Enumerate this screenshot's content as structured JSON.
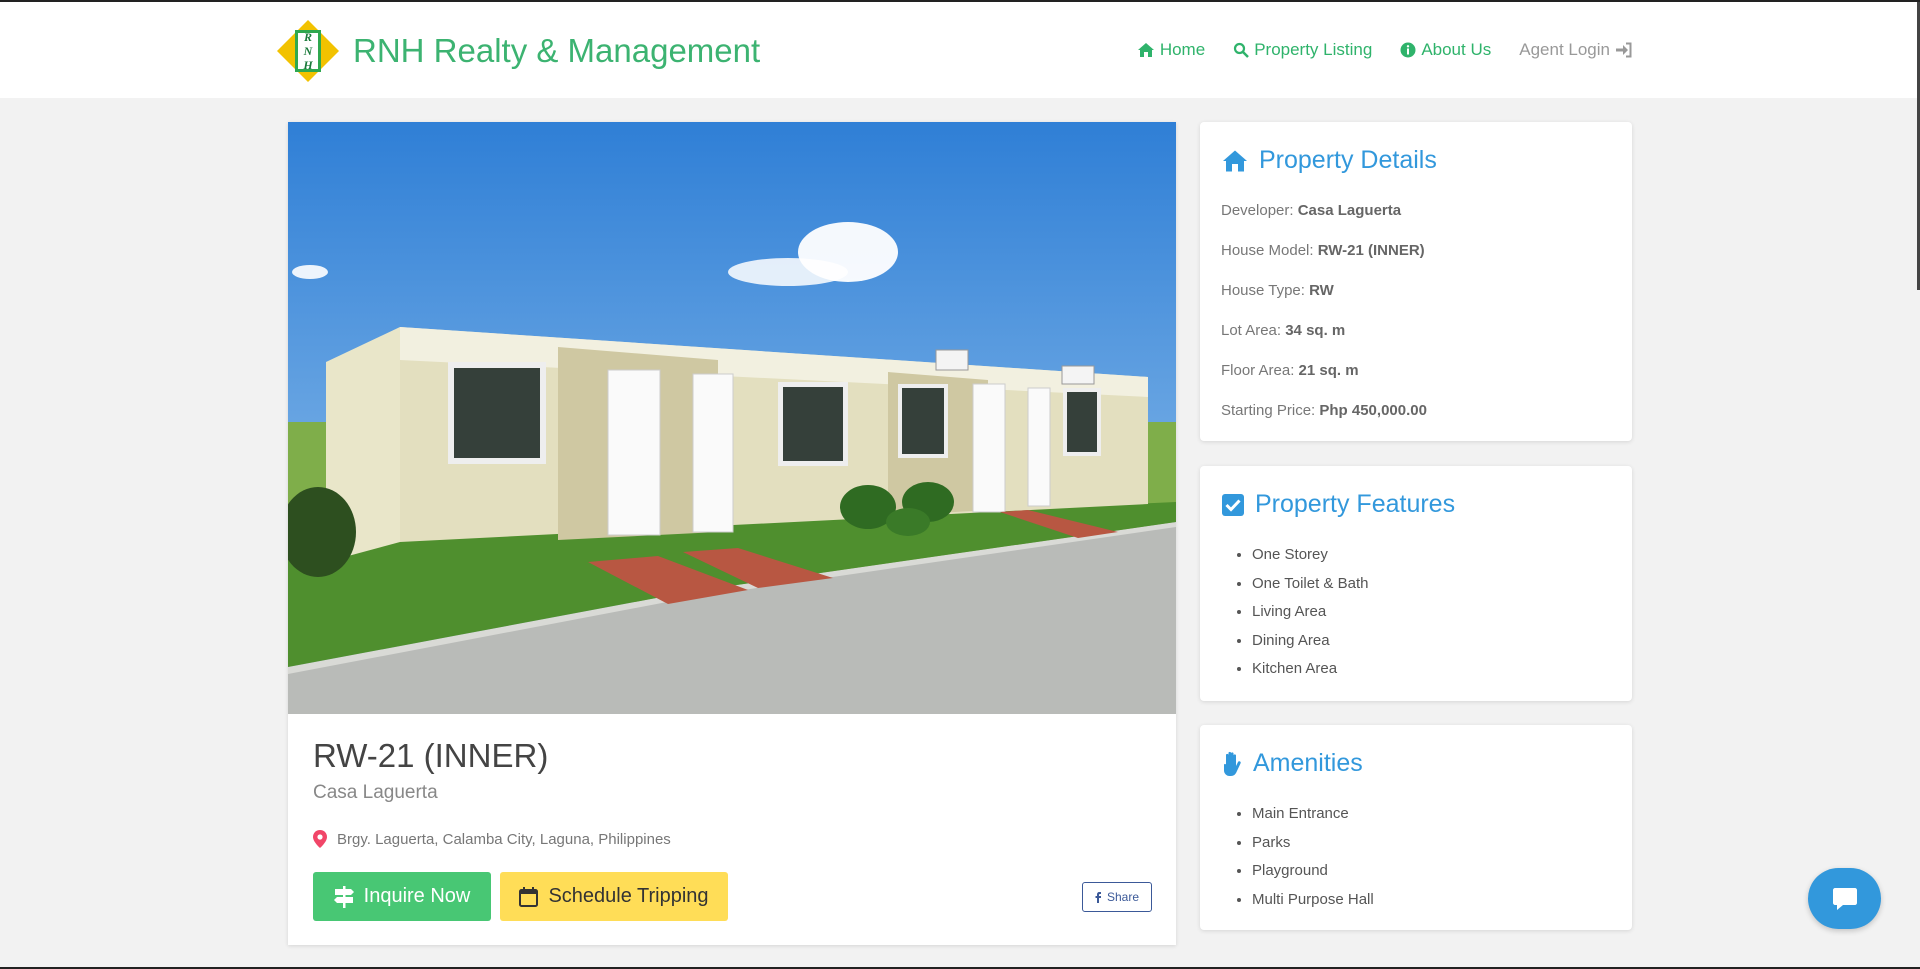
{
  "brand": {
    "name": "RNH Realty & Management",
    "logo_letters": [
      "R",
      "N",
      "H"
    ]
  },
  "nav": {
    "home": "Home",
    "listing": "Property Listing",
    "about": "About Us",
    "login": "Agent Login"
  },
  "property": {
    "title": "RW-21 (INNER)",
    "developer": "Casa Laguerta",
    "address": "Brgy. Laguerta, Calamba City, Laguna, Philippines"
  },
  "actions": {
    "inquire": "Inquire Now",
    "schedule": "Schedule Tripping",
    "share": "Share"
  },
  "details": {
    "heading": "Property Details",
    "rows": [
      {
        "label": "Developer: ",
        "value": "Casa Laguerta"
      },
      {
        "label": "House Model: ",
        "value": "RW-21 (INNER)"
      },
      {
        "label": "House Type: ",
        "value": "RW"
      },
      {
        "label": "Lot Area: ",
        "value": "34 sq. m"
      },
      {
        "label": "Floor Area: ",
        "value": "21 sq. m"
      },
      {
        "label": "Starting Price: ",
        "value": "Php 450,000.00"
      }
    ]
  },
  "features": {
    "heading": "Property Features",
    "items": [
      "One Storey",
      "One Toilet & Bath",
      "Living Area",
      "Dining Area",
      "Kitchen Area"
    ]
  },
  "amenities": {
    "heading": "Amenities",
    "items": [
      "Main Entrance",
      "Parks",
      "Playground",
      "Multi Purpose Hall"
    ]
  },
  "colors": {
    "brand_green": "#3cb371",
    "nav_green": "#2fb36b",
    "accent_blue": "#3298dc",
    "btn_green": "#48c774",
    "btn_yellow": "#ffdd57",
    "facebook_blue": "#3b5998"
  },
  "icons": {
    "home": "home-icon",
    "listing": "search-icon",
    "about": "info-icon",
    "login": "sign-in-icon",
    "details": "home-icon",
    "features": "check-square-icon",
    "amenities": "hand-icon",
    "address": "map-marker-icon",
    "inquire": "signpost-icon",
    "schedule": "calendar-icon",
    "share": "facebook-icon",
    "chat": "chat-icon"
  }
}
